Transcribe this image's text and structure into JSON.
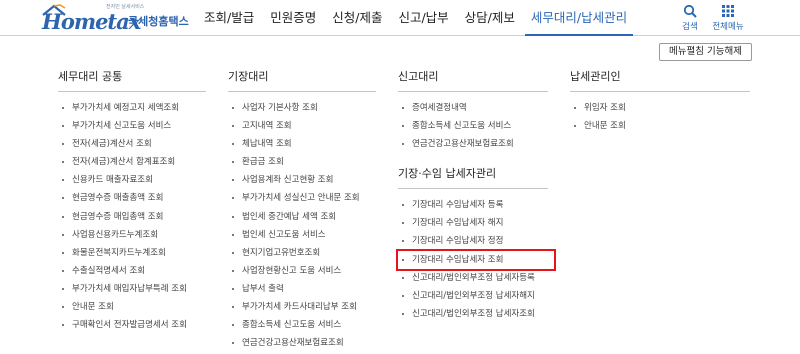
{
  "header": {
    "logo": {
      "tagline": "전자민 날세서비스",
      "brand": "Hometax",
      "agency": "국세청홈택스"
    },
    "nav": [
      {
        "label": "조회/발급",
        "active": false
      },
      {
        "label": "민원증명",
        "active": false
      },
      {
        "label": "신청/제출",
        "active": false
      },
      {
        "label": "신고/납부",
        "active": false
      },
      {
        "label": "상담/제보",
        "active": false
      },
      {
        "label": "세무대리/납세관리",
        "active": true
      }
    ],
    "tools": {
      "search_label": "검색",
      "menu_label": "전체메뉴"
    }
  },
  "toggle_button": "메뉴펼침 기능해제",
  "columns": [
    {
      "title": "세무대리 공통",
      "items": [
        "부가가치세 예정고지 세액조회",
        "부가가치세 신고도움 서비스",
        "전자(세금)계산서 조회",
        "전자(세금)계산서 합계표조회",
        "신용카드 매출자료조회",
        "현금영수증 매출총액 조회",
        "현금영수증 매입총액 조회",
        "사업용신용카드누계조회",
        "화물운전복지카드누계조회",
        "수출실적명세서 조회",
        "부가가치세 매입자납부특례 조회",
        "안내문 조회",
        "구매확인서 전자발급명세서 조회"
      ]
    },
    {
      "title": "기장대리",
      "items": [
        "사업자 기본사항 조회",
        "고지내역 조회",
        "체납내역 조회",
        "환급금 조회",
        "사업용계좌 신고현황 조회",
        "부가가치세 성실신고 안내문 조회",
        "법인세 중간예납 세액 조회",
        "법인세 신고도움 서비스",
        "현지기업고유번호조회",
        "사업장현황신고 도움 서비스",
        "납부서 출력",
        "부가가치세 카드사대리납부 조회",
        "종합소득세 신고도움 서비스",
        "연금건강고용산재보험료조회"
      ]
    },
    {
      "title": "신고대리",
      "items": [
        "증여세결정내역",
        "종합소득세 신고도움 서비스",
        "연금건강고용산재보험료조회"
      ],
      "subsection": {
        "title": "기장·수임 납세자관리",
        "items": [
          "기장대리 수임납세자 등록",
          "기장대리 수임납세자 해지",
          "기장대리 수임납세자 정정",
          "기장대리 수임납세자 조회",
          "신고대리/법인외부조정 납세자등록",
          "신고대리/법인외부조정 납세자해지",
          "신고대리/법인외부조정 납세자조회"
        ],
        "highlighted_index": 3
      }
    },
    {
      "title": "납세관리인",
      "items": [
        "위임자 조회",
        "안내문 조회"
      ]
    }
  ],
  "colors": {
    "brand": "#2d64ae",
    "active_nav": "#2a67b6",
    "highlight_box": "#e8141b"
  }
}
